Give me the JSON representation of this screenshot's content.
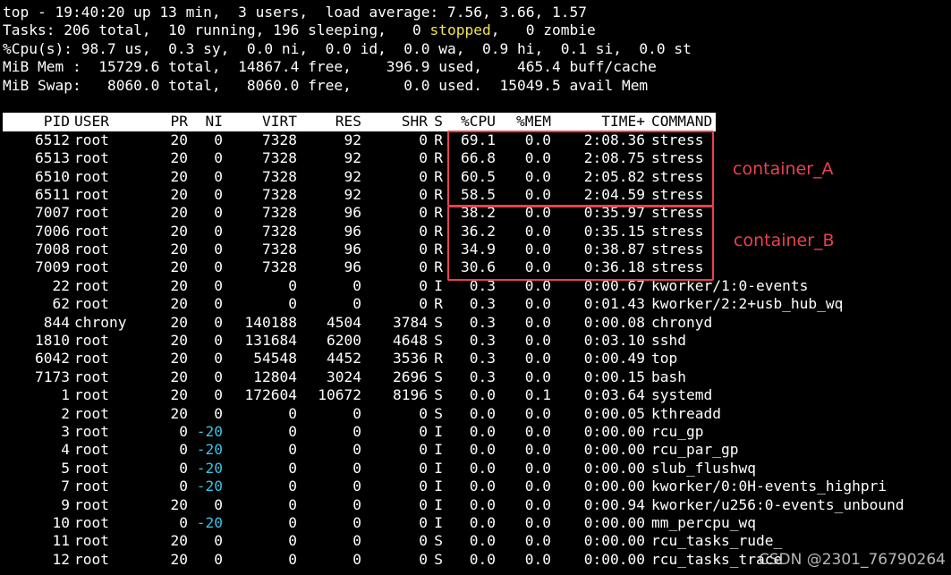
{
  "summary": {
    "line1": "top - 19:40:20 up 13 min,  3 users,  load average: 7.56, 3.66, 1.57",
    "line2_pre": "Tasks: 206 total,  10 running, 196 sleeping,   0 ",
    "line2_stopped": "stopped",
    "line2_post": ",   0 zombie",
    "line3": "%Cpu(s): 98.7 us,  0.3 sy,  0.0 ni,  0.0 id,  0.0 wa,  0.9 hi,  0.1 si,  0.0 st",
    "line4": "MiB Mem :  15729.6 total,  14867.4 free,    396.9 used,    465.4 buff/cache",
    "line5": "MiB Swap:   8060.0 total,   8060.0 free,      0.0 used.  15049.5 avail Mem"
  },
  "columns": {
    "pid": "PID",
    "user": "USER",
    "pr": "PR",
    "ni": "NI",
    "virt": "VIRT",
    "res": "RES",
    "shr": "SHR",
    "s": "S",
    "cpu": "%CPU",
    "mem": "%MEM",
    "time": "TIME+",
    "command": "COMMAND"
  },
  "rows": [
    {
      "pid": "6512",
      "user": "root",
      "pr": "20",
      "ni": "0",
      "virt": "7328",
      "res": "92",
      "shr": "0",
      "s": "R",
      "cpu": "69.1",
      "mem": "0.0",
      "time": "2:08.36",
      "command": "stress"
    },
    {
      "pid": "6513",
      "user": "root",
      "pr": "20",
      "ni": "0",
      "virt": "7328",
      "res": "92",
      "shr": "0",
      "s": "R",
      "cpu": "66.8",
      "mem": "0.0",
      "time": "2:08.75",
      "command": "stress"
    },
    {
      "pid": "6510",
      "user": "root",
      "pr": "20",
      "ni": "0",
      "virt": "7328",
      "res": "92",
      "shr": "0",
      "s": "R",
      "cpu": "60.5",
      "mem": "0.0",
      "time": "2:05.82",
      "command": "stress"
    },
    {
      "pid": "6511",
      "user": "root",
      "pr": "20",
      "ni": "0",
      "virt": "7328",
      "res": "92",
      "shr": "0",
      "s": "R",
      "cpu": "58.5",
      "mem": "0.0",
      "time": "2:04.59",
      "command": "stress"
    },
    {
      "pid": "7007",
      "user": "root",
      "pr": "20",
      "ni": "0",
      "virt": "7328",
      "res": "96",
      "shr": "0",
      "s": "R",
      "cpu": "38.2",
      "mem": "0.0",
      "time": "0:35.97",
      "command": "stress"
    },
    {
      "pid": "7006",
      "user": "root",
      "pr": "20",
      "ni": "0",
      "virt": "7328",
      "res": "96",
      "shr": "0",
      "s": "R",
      "cpu": "36.2",
      "mem": "0.0",
      "time": "0:35.15",
      "command": "stress"
    },
    {
      "pid": "7008",
      "user": "root",
      "pr": "20",
      "ni": "0",
      "virt": "7328",
      "res": "96",
      "shr": "0",
      "s": "R",
      "cpu": "34.9",
      "mem": "0.0",
      "time": "0:38.87",
      "command": "stress"
    },
    {
      "pid": "7009",
      "user": "root",
      "pr": "20",
      "ni": "0",
      "virt": "7328",
      "res": "96",
      "shr": "0",
      "s": "R",
      "cpu": "30.6",
      "mem": "0.0",
      "time": "0:36.18",
      "command": "stress"
    },
    {
      "pid": "22",
      "user": "root",
      "pr": "20",
      "ni": "0",
      "virt": "0",
      "res": "0",
      "shr": "0",
      "s": "I",
      "cpu": "0.3",
      "mem": "0.0",
      "time": "0:00.67",
      "command": "kworker/1:0-events"
    },
    {
      "pid": "62",
      "user": "root",
      "pr": "20",
      "ni": "0",
      "virt": "0",
      "res": "0",
      "shr": "0",
      "s": "R",
      "cpu": "0.3",
      "mem": "0.0",
      "time": "0:01.43",
      "command": "kworker/2:2+usb_hub_wq"
    },
    {
      "pid": "844",
      "user": "chrony",
      "pr": "20",
      "ni": "0",
      "virt": "140188",
      "res": "4504",
      "shr": "3784",
      "s": "S",
      "cpu": "0.3",
      "mem": "0.0",
      "time": "0:00.08",
      "command": "chronyd"
    },
    {
      "pid": "1810",
      "user": "root",
      "pr": "20",
      "ni": "0",
      "virt": "131684",
      "res": "6200",
      "shr": "4648",
      "s": "S",
      "cpu": "0.3",
      "mem": "0.0",
      "time": "0:03.10",
      "command": "sshd"
    },
    {
      "pid": "6042",
      "user": "root",
      "pr": "20",
      "ni": "0",
      "virt": "54548",
      "res": "4452",
      "shr": "3536",
      "s": "R",
      "cpu": "0.3",
      "mem": "0.0",
      "time": "0:00.49",
      "command": "top"
    },
    {
      "pid": "7173",
      "user": "root",
      "pr": "20",
      "ni": "0",
      "virt": "12804",
      "res": "3024",
      "shr": "2696",
      "s": "S",
      "cpu": "0.3",
      "mem": "0.0",
      "time": "0:00.15",
      "command": "bash"
    },
    {
      "pid": "1",
      "user": "root",
      "pr": "20",
      "ni": "0",
      "virt": "172604",
      "res": "10672",
      "shr": "8196",
      "s": "S",
      "cpu": "0.0",
      "mem": "0.1",
      "time": "0:03.64",
      "command": "systemd"
    },
    {
      "pid": "2",
      "user": "root",
      "pr": "20",
      "ni": "0",
      "virt": "0",
      "res": "0",
      "shr": "0",
      "s": "S",
      "cpu": "0.0",
      "mem": "0.0",
      "time": "0:00.05",
      "command": "kthreadd"
    },
    {
      "pid": "3",
      "user": "root",
      "pr": "0",
      "ni": "-20",
      "virt": "0",
      "res": "0",
      "shr": "0",
      "s": "I",
      "cpu": "0.0",
      "mem": "0.0",
      "time": "0:00.00",
      "command": "rcu_gp"
    },
    {
      "pid": "4",
      "user": "root",
      "pr": "0",
      "ni": "-20",
      "virt": "0",
      "res": "0",
      "shr": "0",
      "s": "I",
      "cpu": "0.0",
      "mem": "0.0",
      "time": "0:00.00",
      "command": "rcu_par_gp"
    },
    {
      "pid": "5",
      "user": "root",
      "pr": "0",
      "ni": "-20",
      "virt": "0",
      "res": "0",
      "shr": "0",
      "s": "I",
      "cpu": "0.0",
      "mem": "0.0",
      "time": "0:00.00",
      "command": "slub_flushwq"
    },
    {
      "pid": "7",
      "user": "root",
      "pr": "0",
      "ni": "-20",
      "virt": "0",
      "res": "0",
      "shr": "0",
      "s": "I",
      "cpu": "0.0",
      "mem": "0.0",
      "time": "0:00.00",
      "command": "kworker/0:0H-events_highpri"
    },
    {
      "pid": "9",
      "user": "root",
      "pr": "20",
      "ni": "0",
      "virt": "0",
      "res": "0",
      "shr": "0",
      "s": "I",
      "cpu": "0.0",
      "mem": "0.0",
      "time": "0:00.94",
      "command": "kworker/u256:0-events_unbound"
    },
    {
      "pid": "10",
      "user": "root",
      "pr": "0",
      "ni": "-20",
      "virt": "0",
      "res": "0",
      "shr": "0",
      "s": "I",
      "cpu": "0.0",
      "mem": "0.0",
      "time": "0:00.00",
      "command": "mm_percpu_wq"
    },
    {
      "pid": "11",
      "user": "root",
      "pr": "20",
      "ni": "0",
      "virt": "0",
      "res": "0",
      "shr": "0",
      "s": "S",
      "cpu": "0.0",
      "mem": "0.0",
      "time": "0:00.00",
      "command": "rcu_tasks_rude_"
    },
    {
      "pid": "12",
      "user": "root",
      "pr": "20",
      "ni": "0",
      "virt": "0",
      "res": "0",
      "shr": "0",
      "s": "S",
      "cpu": "0.0",
      "mem": "0.0",
      "time": "0:00.00",
      "command": "rcu_tasks_trace"
    }
  ],
  "annotations": {
    "container_a": "container_A",
    "container_b": "container_B"
  },
  "watermark": "CSDN @2301_76790264",
  "colors": {
    "background": "#000000",
    "text": "#ffffff",
    "header_bar": "#ffffff",
    "stopped": "#f0e34f",
    "negative_nice": "#39c2e6",
    "annotation": "#e8424c"
  }
}
